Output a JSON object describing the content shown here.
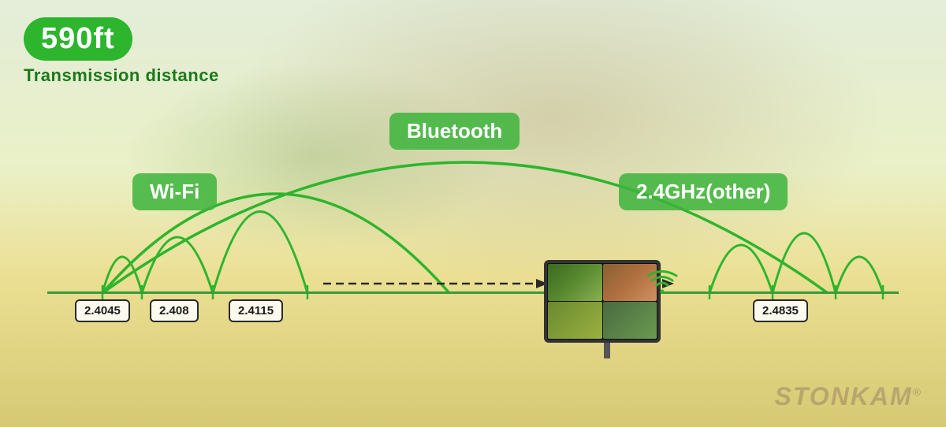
{
  "badge": {
    "distance": "590ft",
    "transmission_label": "Transmission distance"
  },
  "labels": {
    "wifi": "Wi-Fi",
    "bluetooth": "Bluetooth",
    "ghz_other": "2.4GHz(other)"
  },
  "frequencies": {
    "f1": "2.4045",
    "f2": "2.408",
    "f3": "2.4115",
    "f4": "2.4835"
  },
  "watermark": "STONKAM",
  "colors": {
    "green": "#2db52d",
    "dark_green": "#1a7a1a",
    "text_dark": "#1a1a1a"
  }
}
